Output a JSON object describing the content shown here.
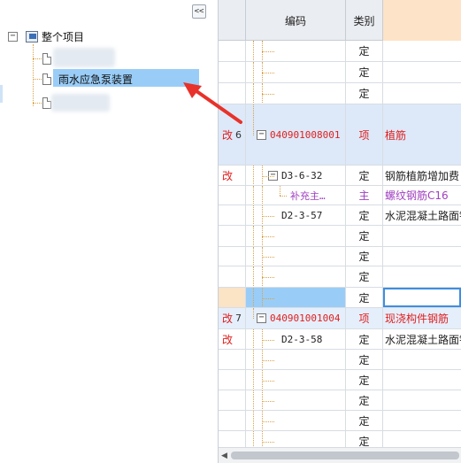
{
  "tree": {
    "collapse_label": "<<",
    "root_toggle": "−",
    "root_label": "整个项目",
    "selected_label": "雨水应急泵装置"
  },
  "grid": {
    "headers": {
      "code": "编码",
      "type": "类别"
    },
    "rows": [
      {
        "mark": "",
        "num": "",
        "code": "",
        "type": "定",
        "name": ""
      },
      {
        "mark": "",
        "num": "",
        "code": "",
        "type": "定",
        "name": ""
      },
      {
        "mark": "",
        "num": "",
        "code": "",
        "type": "定",
        "name": ""
      },
      {
        "mark": "改",
        "num": "6",
        "code": "040901008001",
        "type": "项",
        "name": "植筋"
      },
      {
        "mark": "改",
        "num": "",
        "code": "D3-6-32",
        "type": "定",
        "name": "钢筋植筋增加费"
      },
      {
        "mark": "",
        "num": "",
        "code": "补充主…",
        "type": "主",
        "name": "螺纹钢筋C16"
      },
      {
        "mark": "",
        "num": "",
        "code": "D2-3-57",
        "type": "定",
        "name": "水泥混凝土路面钢筋"
      },
      {
        "mark": "",
        "num": "",
        "code": "",
        "type": "定",
        "name": ""
      },
      {
        "mark": "",
        "num": "",
        "code": "",
        "type": "定",
        "name": ""
      },
      {
        "mark": "",
        "num": "",
        "code": "",
        "type": "定",
        "name": ""
      },
      {
        "mark": "",
        "num": "",
        "code": "",
        "type": "定",
        "name": ""
      },
      {
        "mark": "改",
        "num": "7",
        "code": "040901001004",
        "type": "项",
        "name": "现浇构件钢筋"
      },
      {
        "mark": "改",
        "num": "",
        "code": "D2-3-58",
        "type": "定",
        "name": "水泥混凝土路面钢筋"
      },
      {
        "mark": "",
        "num": "",
        "code": "",
        "type": "定",
        "name": ""
      },
      {
        "mark": "",
        "num": "",
        "code": "",
        "type": "定",
        "name": ""
      },
      {
        "mark": "",
        "num": "",
        "code": "",
        "type": "定",
        "name": ""
      },
      {
        "mark": "",
        "num": "",
        "code": "",
        "type": "定",
        "name": ""
      },
      {
        "mark": "",
        "num": "",
        "code": "",
        "type": "定",
        "name": ""
      }
    ]
  },
  "scrollbar": {
    "left_arrow": "◀"
  },
  "colors": {
    "accent_red": "#e02020",
    "accent_purple": "#a040c0",
    "selection_blue": "#99cdf7",
    "arrow_red": "#e8322a"
  }
}
